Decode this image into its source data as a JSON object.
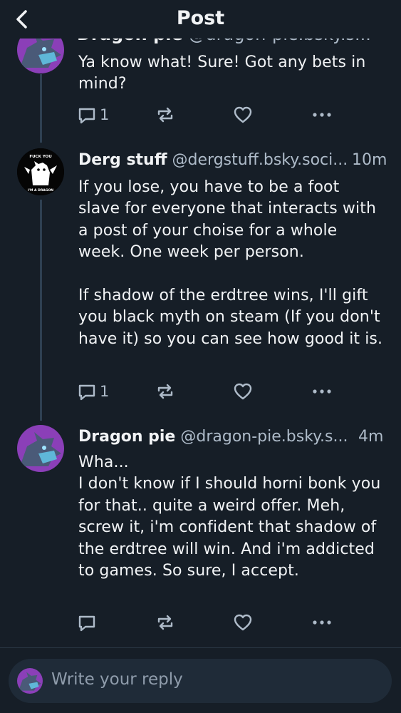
{
  "header": {
    "title": "Post",
    "back_icon": "chevron-left-icon"
  },
  "cut_off_post": {
    "name": "Dragon pie",
    "handle": "@dragon-pie.bsky.s...",
    "text": "Ya know what! Sure! Got any bets in mind?",
    "reply_count": "1",
    "icons": [
      "reply-icon",
      "repost-icon",
      "like-icon",
      "more-icon"
    ]
  },
  "posts": [
    {
      "name": "Derg stuff",
      "handle": "@dergstuff.bsky.soci...",
      "time": "10m",
      "avatar_text_top": "FUCK YOU",
      "avatar_text_bottom": "I'M A DRAGON",
      "text": "If you lose, you have to be a foot slave for everyone that interacts with a post of your choise for a whole week. One week per person.\n\nIf shadow of the erdtree wins, I'll gift you black myth on steam (If you don't have it) so you can see how good it is.",
      "reply_count": "1"
    },
    {
      "name": "Dragon pie",
      "handle": "@dragon-pie.bsky.s...",
      "time": "4m",
      "text": "Wha...\nI don't know if I should horni bonk you for that.. quite a weird offer. Meh, screw it, i'm confident that shadow of the erdtree will win. And i'm addicted to games. So sure, I accept.",
      "reply_count": ""
    }
  ],
  "reply_bar": {
    "placeholder": "Write your reply"
  },
  "colors": {
    "background": "#161e27",
    "muted_text": "#aebbc9",
    "thread_line": "#2e4052",
    "input_bg": "#1f2b38"
  }
}
